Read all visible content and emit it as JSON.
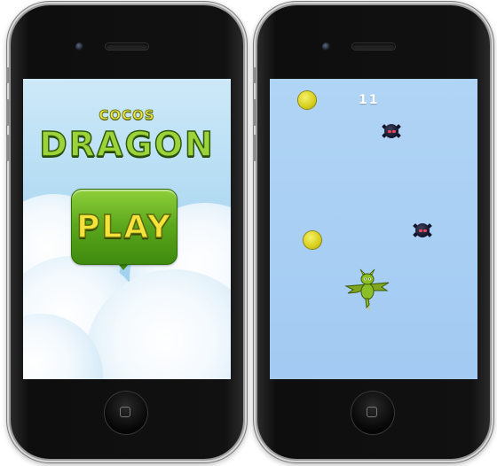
{
  "left_phone": {
    "title_small": "COCOS",
    "title_big": "DRAGON",
    "play_label": "PLAY"
  },
  "right_phone": {
    "score": "11"
  },
  "icons": {
    "coin": "coin-icon",
    "enemy": "bomb-enemy-icon",
    "player": "dragon-icon"
  },
  "colors": {
    "title_yellow": "#f7e64a",
    "title_green": "#9cd23a",
    "play_green": "#5aa61c",
    "sky_menu": "#a9d6f1",
    "sky_game": "#a6cdf3",
    "coin": "#e8e23a"
  }
}
